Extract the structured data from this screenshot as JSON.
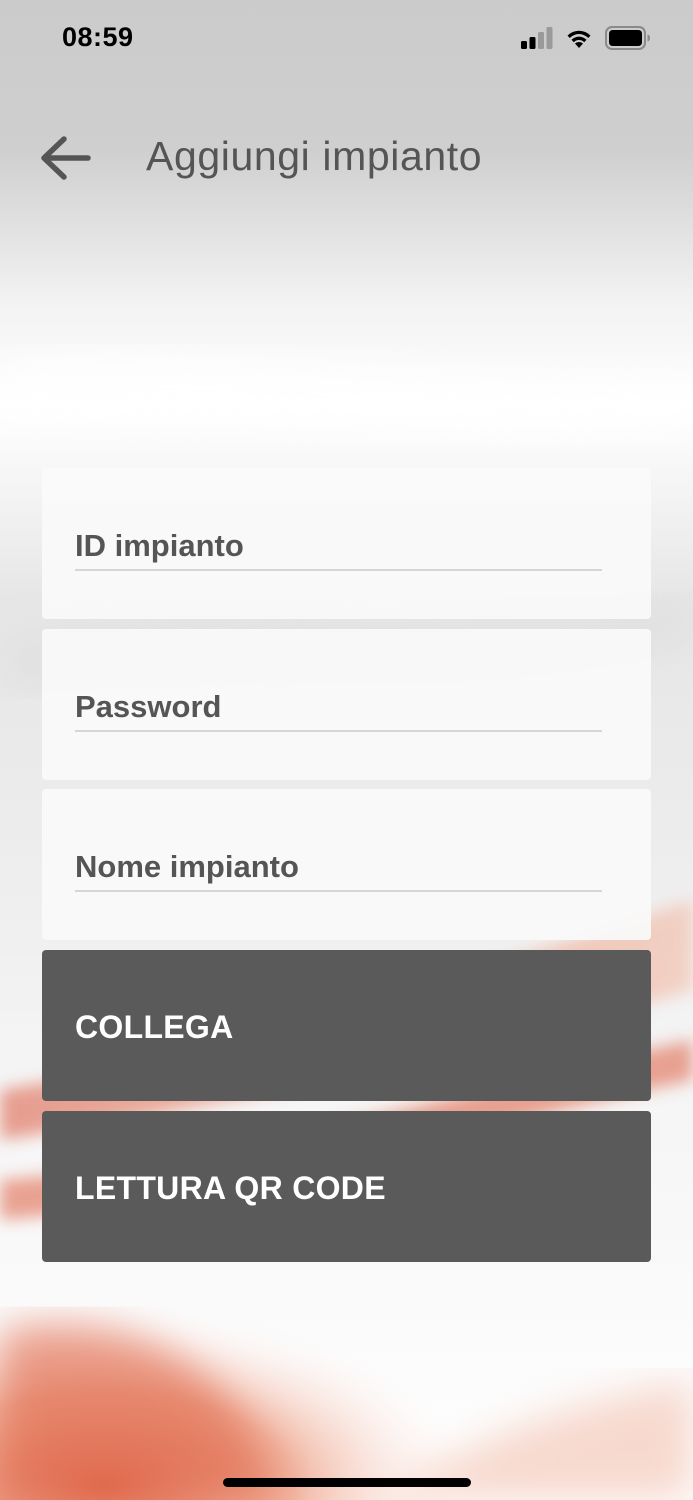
{
  "status_bar": {
    "time": "08:59",
    "icons": [
      "cellular-signal-icon",
      "wifi-icon",
      "battery-icon"
    ]
  },
  "header": {
    "back_icon": "arrow-left-icon",
    "title": "Aggiungi impianto"
  },
  "form": {
    "fields": [
      {
        "placeholder": "ID impianto",
        "value": ""
      },
      {
        "placeholder": "Password",
        "value": ""
      },
      {
        "placeholder": "Nome impianto",
        "value": ""
      }
    ]
  },
  "actions": {
    "connect_label": "COLLEGA",
    "qr_label": "LETTURA QR CODE"
  },
  "colors": {
    "button_bg": "#5b5a5a",
    "title_text": "#555555",
    "accent_orange": "#e0603c"
  }
}
